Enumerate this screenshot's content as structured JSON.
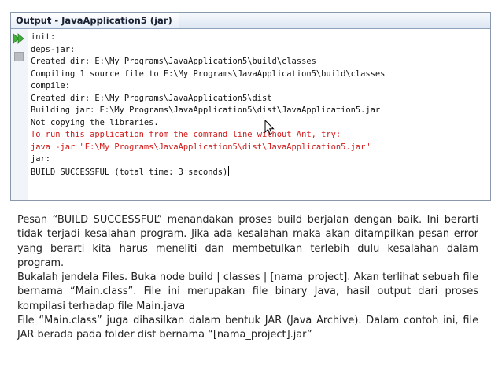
{
  "output_window": {
    "title": "Output - JavaApplication5 (jar)",
    "toolbar": {
      "rerun_icon": "double-play-icon",
      "stop_icon": "stop-icon"
    },
    "lines": [
      {
        "text": "init:",
        "type": "normal"
      },
      {
        "text": "deps-jar:",
        "type": "normal"
      },
      {
        "text": "Created dir: E:\\My Programs\\JavaApplication5\\build\\classes",
        "type": "normal"
      },
      {
        "text": "Compiling 1 source file to E:\\My Programs\\JavaApplication5\\build\\classes",
        "type": "normal"
      },
      {
        "text": "compile:",
        "type": "normal"
      },
      {
        "text": "Created dir: E:\\My Programs\\JavaApplication5\\dist",
        "type": "normal"
      },
      {
        "text": "Building jar: E:\\My Programs\\JavaApplication5\\dist\\JavaApplication5.jar",
        "type": "normal"
      },
      {
        "text": "Not copying the libraries.",
        "type": "normal"
      },
      {
        "text": "To run this application from the command line without Ant, try:",
        "type": "error"
      },
      {
        "text": "java -jar \"E:\\My Programs\\JavaApplication5\\dist\\JavaApplication5.jar\"",
        "type": "error"
      },
      {
        "text": "jar:",
        "type": "normal"
      },
      {
        "text": "BUILD SUCCESSFUL (total time: 3 seconds)",
        "type": "normal"
      }
    ],
    "colors": {
      "normal": "#111111",
      "error": "#d21a1a"
    }
  },
  "description": {
    "paragraphs": [
      "Pesan “BUILD SUCCESSFUL” menandakan proses build berjalan dengan baik. Ini berarti tidak terjadi kesalahan program. Jika ada kesalahan maka akan ditampilkan pesan error yang berarti kita harus meneliti dan membetulkan terlebih dulu kesalahan dalam program.",
      "Bukalah jendela Files. Buka node build | classes | [nama_project]. Akan terlihat sebuah file bernama “Main.class”. File ini merupakan file binary Java, hasil output dari proses kompilasi terhadap file Main.java",
      "File “Main.class” juga dihasilkan dalam bentuk JAR (Java Archive). Dalam contoh ini, file JAR berada pada folder dist bernama “[nama_project].jar”"
    ]
  }
}
